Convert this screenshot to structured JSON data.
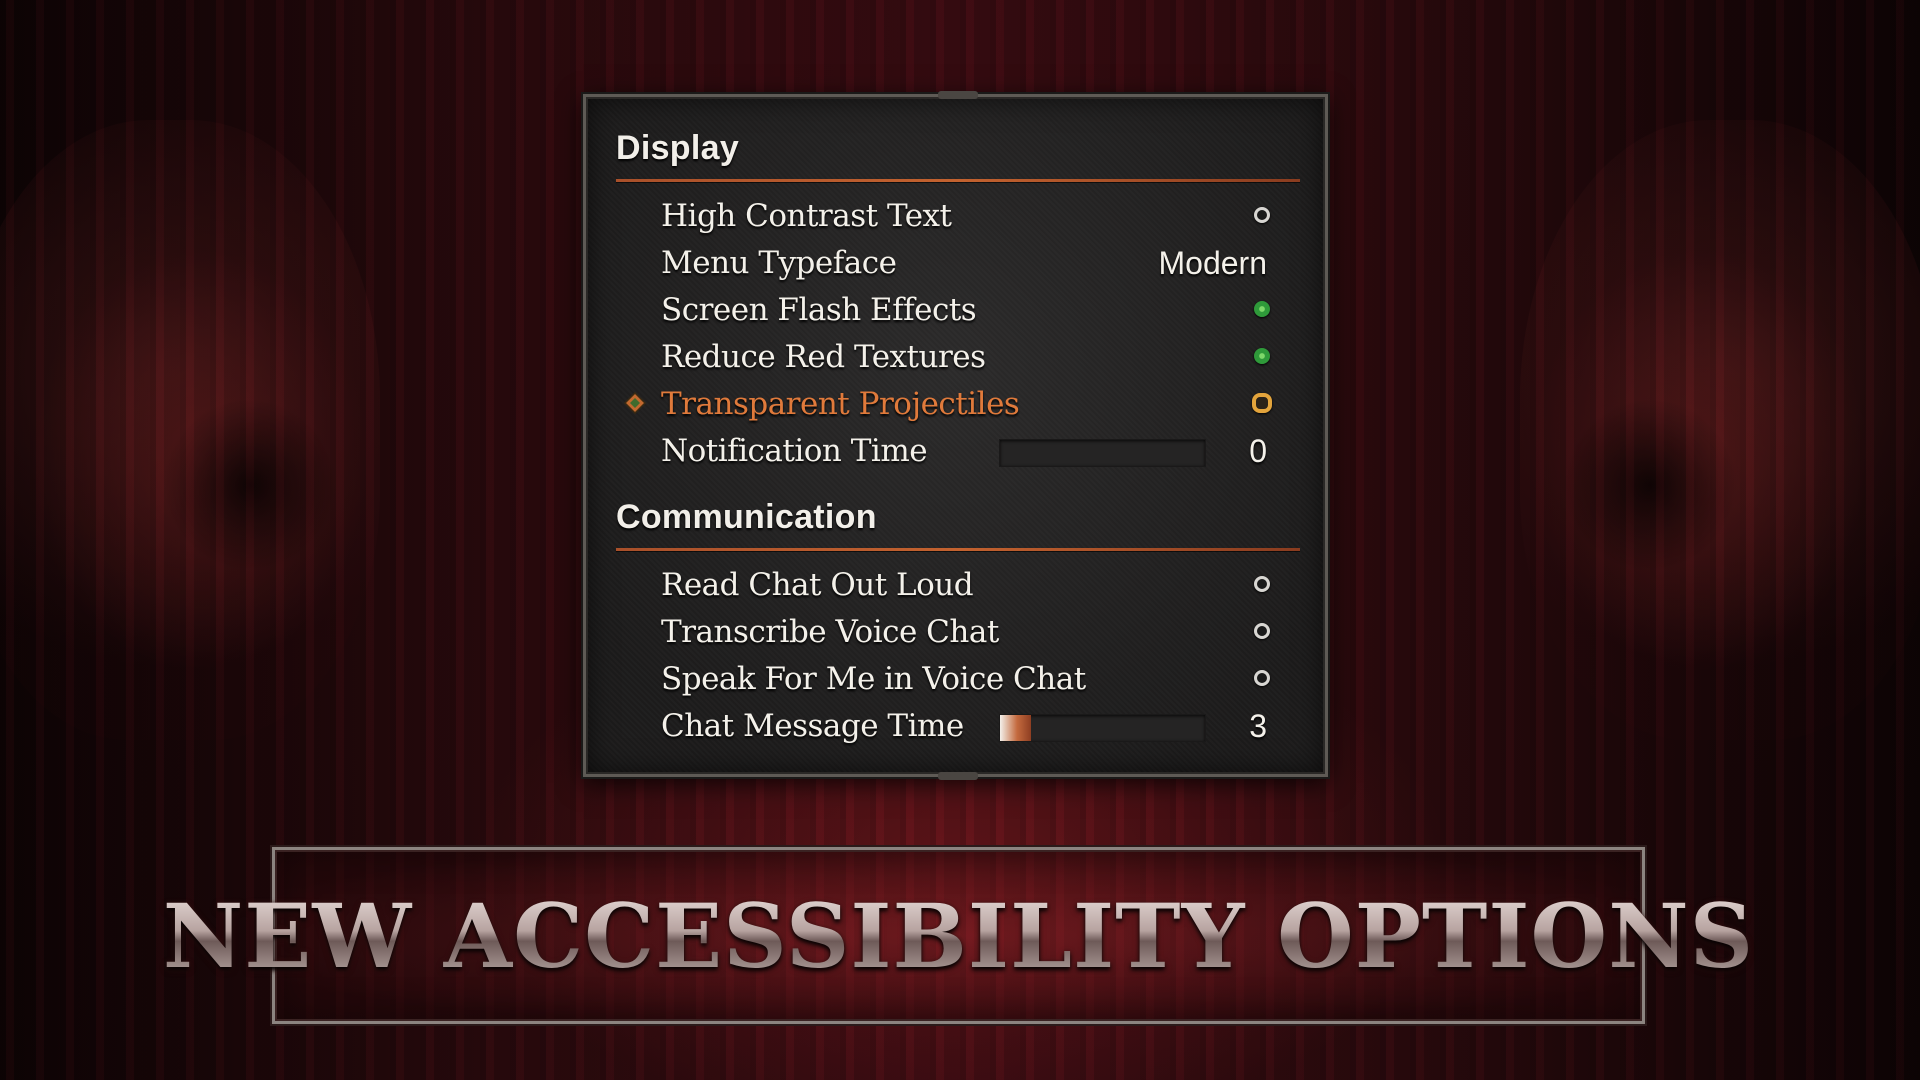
{
  "sections": [
    {
      "title": "Display",
      "rows": [
        {
          "label": "High Contrast Text",
          "type": "toggle",
          "state": "off"
        },
        {
          "label": "Menu Typeface",
          "type": "value",
          "value": "Modern"
        },
        {
          "label": "Screen Flash Effects",
          "type": "toggle",
          "state": "on"
        },
        {
          "label": "Reduce Red Textures",
          "type": "toggle",
          "state": "on"
        },
        {
          "label": "Transparent Projectiles",
          "type": "toggle",
          "state": "off",
          "selected": true
        },
        {
          "label": "Notification Time",
          "type": "slider",
          "value": "0",
          "fill_fraction": 0.0
        }
      ]
    },
    {
      "title": "Communication",
      "rows": [
        {
          "label": "Read Chat Out Loud",
          "type": "toggle",
          "state": "off"
        },
        {
          "label": "Transcribe Voice Chat",
          "type": "toggle",
          "state": "off"
        },
        {
          "label": "Speak For Me in Voice Chat",
          "type": "toggle",
          "state": "off"
        },
        {
          "label": "Chat Message Time",
          "type": "slider",
          "value": "3",
          "fill_fraction": 0.15
        }
      ]
    }
  ],
  "banner": {
    "text": "NEW ACCESSIBILITY OPTIONS"
  },
  "colors": {
    "accent": "#e07a3b",
    "toggle_on": "#2f9a3a",
    "rule": "#c3622f"
  }
}
